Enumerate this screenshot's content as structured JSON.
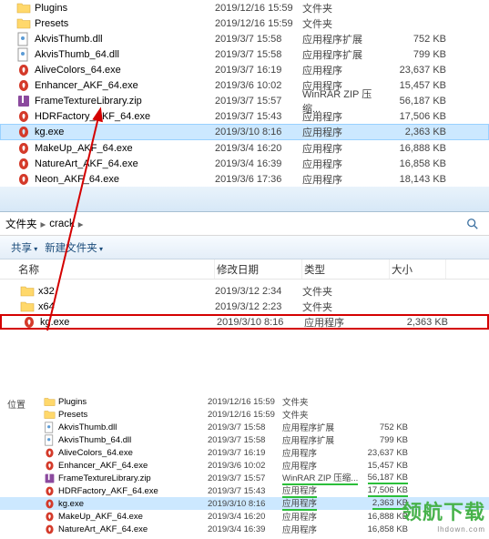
{
  "top_files": [
    {
      "icon": "folder",
      "name": "Plugins",
      "date": "2019/12/16 15:59",
      "type": "文件夹",
      "size": ""
    },
    {
      "icon": "folder",
      "name": "Presets",
      "date": "2019/12/16 15:59",
      "type": "文件夹",
      "size": ""
    },
    {
      "icon": "dll",
      "name": "AkvisThumb.dll",
      "date": "2019/3/7 15:58",
      "type": "应用程序扩展",
      "size": "752 KB"
    },
    {
      "icon": "dll",
      "name": "AkvisThumb_64.dll",
      "date": "2019/3/7 15:58",
      "type": "应用程序扩展",
      "size": "799 KB"
    },
    {
      "icon": "app-red",
      "name": "AliveColors_64.exe",
      "date": "2019/3/7 16:19",
      "type": "应用程序",
      "size": "23,637 KB"
    },
    {
      "icon": "app-red",
      "name": "Enhancer_AKF_64.exe",
      "date": "2019/3/6 10:02",
      "type": "应用程序",
      "size": "15,457 KB"
    },
    {
      "icon": "zip",
      "name": "FrameTextureLibrary.zip",
      "date": "2019/3/7 15:57",
      "type": "WinRAR ZIP 压缩...",
      "size": "56,187 KB"
    },
    {
      "icon": "app-red",
      "name": "HDRFactory_AKF_64.exe",
      "date": "2019/3/7 15:43",
      "type": "应用程序",
      "size": "17,506 KB"
    },
    {
      "icon": "app-red",
      "name": "kg.exe",
      "date": "2019/3/10 8:16",
      "type": "应用程序",
      "size": "2,363 KB",
      "selected": true
    },
    {
      "icon": "app-red",
      "name": "MakeUp_AKF_64.exe",
      "date": "2019/3/4 16:20",
      "type": "应用程序",
      "size": "16,888 KB"
    },
    {
      "icon": "app-red",
      "name": "NatureArt_AKF_64.exe",
      "date": "2019/3/4 16:39",
      "type": "应用程序",
      "size": "16,858 KB"
    },
    {
      "icon": "app-red",
      "name": "Neon_AKF_64.exe",
      "date": "2019/3/6 17:36",
      "type": "应用程序",
      "size": "18,143 KB"
    }
  ],
  "breadcrumb": {
    "segment1": "文件夹",
    "segment2": "crack"
  },
  "toolbar": {
    "share": "共享",
    "new_folder": "新建文件夹"
  },
  "headers": {
    "name": "名称",
    "date": "修改日期",
    "type": "类型",
    "size": "大小"
  },
  "second_files": [
    {
      "icon": "folder",
      "name": "x32",
      "date": "2019/3/12 2:34",
      "type": "文件夹",
      "size": ""
    },
    {
      "icon": "folder",
      "name": "x64",
      "date": "2019/3/12 2:23",
      "type": "文件夹",
      "size": ""
    },
    {
      "icon": "app-red",
      "name": "kg.exe",
      "date": "2019/3/10 8:16",
      "type": "应用程序",
      "size": "2,363 KB",
      "boxed": true
    }
  ],
  "third_label": "位置",
  "third_files": [
    {
      "icon": "folder",
      "name": "Plugins",
      "date": "2019/12/16 15:59",
      "type": "文件夹",
      "size": ""
    },
    {
      "icon": "folder",
      "name": "Presets",
      "date": "2019/12/16 15:59",
      "type": "文件夹",
      "size": ""
    },
    {
      "icon": "dll",
      "name": "AkvisThumb.dll",
      "date": "2019/3/7 15:58",
      "type": "应用程序扩展",
      "size": "752 KB"
    },
    {
      "icon": "dll",
      "name": "AkvisThumb_64.dll",
      "date": "2019/3/7 15:58",
      "type": "应用程序扩展",
      "size": "799 KB"
    },
    {
      "icon": "app-red",
      "name": "AliveColors_64.exe",
      "date": "2019/3/7 16:19",
      "type": "应用程序",
      "size": "23,637 KB"
    },
    {
      "icon": "app-red",
      "name": "Enhancer_AKF_64.exe",
      "date": "2019/3/6 10:02",
      "type": "应用程序",
      "size": "15,457 KB"
    },
    {
      "icon": "zip",
      "name": "FrameTextureLibrary.zip",
      "date": "2019/3/7 15:57",
      "type": "WinRAR ZIP 压缩...",
      "size": "56,187 KB",
      "green": true
    },
    {
      "icon": "app-red",
      "name": "HDRFactory_AKF_64.exe",
      "date": "2019/3/7 15:43",
      "type": "应用程序",
      "size": "17,506 KB",
      "green": true
    },
    {
      "icon": "app-red",
      "name": "kg.exe",
      "date": "2019/3/10 8:16",
      "type": "应用程序",
      "size": "2,363 KB",
      "hl": true,
      "green": true
    },
    {
      "icon": "app-red",
      "name": "MakeUp_AKF_64.exe",
      "date": "2019/3/4 16:20",
      "type": "应用程序",
      "size": "16,888 KB"
    },
    {
      "icon": "app-red",
      "name": "NatureArt_AKF_64.exe",
      "date": "2019/3/4 16:39",
      "type": "应用程序",
      "size": "16,858 KB"
    }
  ],
  "watermark": {
    "cn": "领航下载",
    "en": "lhdown.com"
  }
}
